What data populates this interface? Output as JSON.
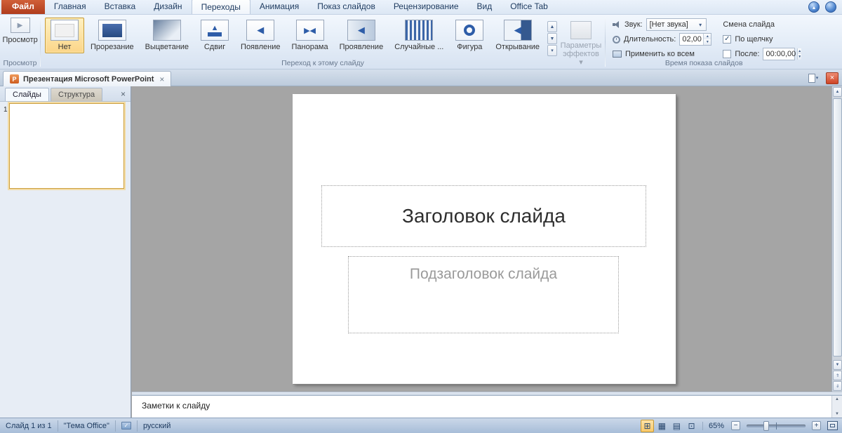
{
  "icons": {
    "close": "×",
    "check": "✓",
    "dropdown": "▾",
    "chevron_up": "▴",
    "up": "▲",
    "down": "▼",
    "left": "◀",
    "right": "▶",
    "double_up": "⇑",
    "double_down": "⇓",
    "minus": "−",
    "plus": "+",
    "view_normal": "⊞",
    "view_sorter": "▦",
    "view_reading": "▤",
    "view_slideshow": "⊡"
  },
  "ribbon": {
    "tabs": [
      {
        "label": "Файл"
      },
      {
        "label": "Главная"
      },
      {
        "label": "Вставка"
      },
      {
        "label": "Дизайн"
      },
      {
        "label": "Переходы"
      },
      {
        "label": "Анимация"
      },
      {
        "label": "Показ слайдов"
      },
      {
        "label": "Рецензирование"
      },
      {
        "label": "Вид"
      },
      {
        "label": "Office Tab"
      }
    ],
    "preview": {
      "label": "Просмотр",
      "group_label": "Просмотр"
    },
    "transitions": [
      {
        "label": "Нет"
      },
      {
        "label": "Прорезание"
      },
      {
        "label": "Выцветание"
      },
      {
        "label": "Сдвиг"
      },
      {
        "label": "Появление"
      },
      {
        "label": "Панорама"
      },
      {
        "label": "Проявление"
      },
      {
        "label": "Случайные ..."
      },
      {
        "label": "Фигура"
      },
      {
        "label": "Открывание"
      }
    ],
    "effect_options_label": "Параметры эффектов",
    "transition_group_label": "Переход к этому слайду",
    "timing": {
      "sound_label": "Звук:",
      "sound_value": "[Нет звука]",
      "duration_label": "Длительность:",
      "duration_value": "02,00",
      "apply_all_label": "Применить ко всем",
      "advance_header": "Смена слайда",
      "on_click_label": "По щелчку",
      "after_label": "После:",
      "after_value": "00:00,00",
      "group_label": "Время показа слайдов"
    }
  },
  "doc_tab": {
    "title": "Презентация Microsoft PowerPoint",
    "icon_letter": "P"
  },
  "left_panel": {
    "slides_tab": "Слайды",
    "outline_tab": "Структура",
    "slide_number": "1"
  },
  "slide": {
    "title_placeholder": "Заголовок слайда",
    "subtitle_placeholder": "Подзаголовок слайда"
  },
  "notes": {
    "text": "Заметки к слайду"
  },
  "status": {
    "slide_info": "Слайд 1 из 1",
    "theme": "\"Тема Office\"",
    "language": "русский",
    "zoom": "65%"
  }
}
